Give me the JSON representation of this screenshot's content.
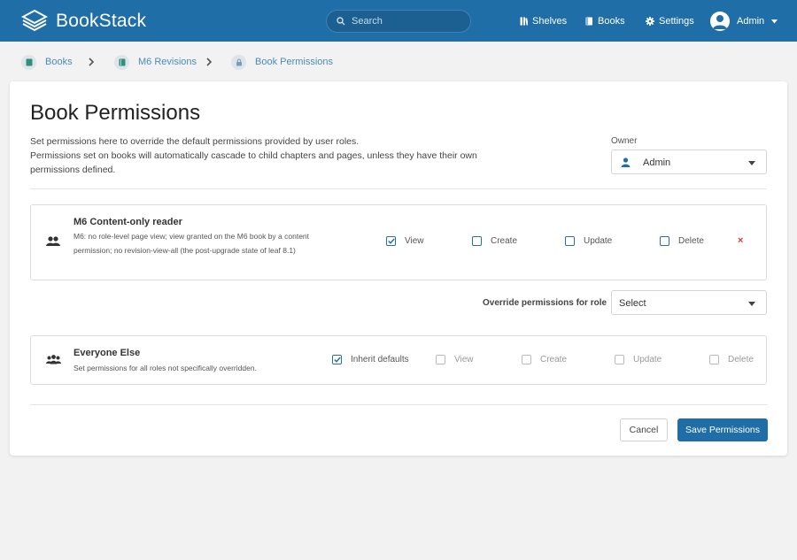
{
  "app": {
    "name": "BookStack"
  },
  "header": {
    "search_placeholder": "Search",
    "nav": [
      {
        "label": "Shelves",
        "icon": "shelves-icon"
      },
      {
        "label": "Books",
        "icon": "books-icon"
      },
      {
        "label": "Settings",
        "icon": "gear-icon"
      }
    ],
    "user_name": "Admin"
  },
  "breadcrumb": [
    {
      "label": "Books",
      "icon": "books-icon"
    },
    {
      "label": "M6 Revisions",
      "icon": "book-icon"
    },
    {
      "label": "Book Permissions",
      "icon": "lock-icon"
    }
  ],
  "page": {
    "title": "Book Permissions",
    "description_lines": [
      "Set permissions here to override the default permissions provided by user roles.",
      "Permissions set on books will automatically cascade to child chapters and pages, unless they have their own permissions defined."
    ],
    "owner_label": "Owner",
    "owner_value": "Admin"
  },
  "role_override": {
    "name": "M6 Content-only reader",
    "description": "M6: no role-level page view; view granted on the M6 book by a content permission; no revision-view-all (the post-upgrade state of leaf 8.1)",
    "permissions": [
      {
        "label": "View",
        "checked": true
      },
      {
        "label": "Create",
        "checked": false
      },
      {
        "label": "Update",
        "checked": false
      },
      {
        "label": "Delete",
        "checked": false
      }
    ],
    "remove_symbol": "×"
  },
  "override_role": {
    "label": "Override permissions for role",
    "select_value": "Select"
  },
  "everyone_else": {
    "name": "Everyone Else",
    "description": "Set permissions for all roles not specifically overridden.",
    "inherit_label": "Inherit defaults",
    "inherit_checked": true,
    "permissions": [
      {
        "label": "View",
        "checked": false
      },
      {
        "label": "Create",
        "checked": false
      },
      {
        "label": "Update",
        "checked": false
      },
      {
        "label": "Delete",
        "checked": false
      }
    ]
  },
  "actions": {
    "cancel_label": "Cancel",
    "save_label": "Save Permissions"
  },
  "colors": {
    "header_bg": "#206ea7",
    "accent": "#206ea7",
    "link": "#4a8bbf",
    "danger": "#d23a3a"
  }
}
